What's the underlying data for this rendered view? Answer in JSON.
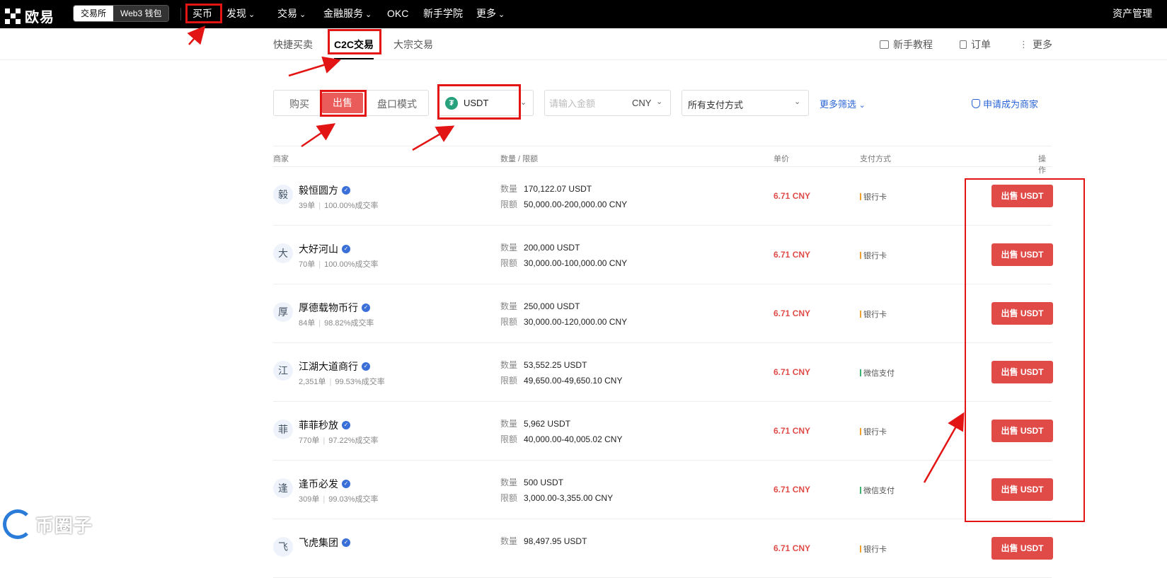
{
  "topnav": {
    "logo": "欧易",
    "segment": {
      "exchange": "交易所",
      "wallet": "Web3 钱包"
    },
    "items": [
      "买币",
      "发现",
      "交易",
      "金融服务",
      "OKC",
      "新手学院",
      "更多"
    ],
    "asset_manage": "资产管理"
  },
  "subnav": {
    "tabs": [
      "快捷买卖",
      "C2C交易",
      "大宗交易"
    ],
    "active_tab": "C2C交易",
    "right": {
      "tutorial": "新手教程",
      "orders": "订单",
      "more": "更多"
    }
  },
  "filters": {
    "trade": {
      "buy": "购买",
      "sell": "出售",
      "orderbook": "盘口模式",
      "active": "出售"
    },
    "coin": "USDT",
    "amount_placeholder": "请输入金额",
    "currency": "CNY",
    "payment": "所有支付方式",
    "more_filters": "更多筛选",
    "apply_merchant": "申请成为商家"
  },
  "table": {
    "headers": {
      "merchant": "商家",
      "qty_limit": "数量 / 限额",
      "price": "单价",
      "payment": "支付方式",
      "action": "操作"
    },
    "qty_label": "数量",
    "limit_label": "限额",
    "rows": [
      {
        "avatar": "毅",
        "name": "毅恒圆方",
        "orders": "39单",
        "rate": "100.00%成交率",
        "qty": "170,122.07 USDT",
        "limit": "50,000.00-200,000.00 CNY",
        "price": "6.71 CNY",
        "payment": "银行卡",
        "pay_color": "#f0a030",
        "action": "出售 USDT"
      },
      {
        "avatar": "大",
        "name": "大好河山",
        "orders": "70单",
        "rate": "100.00%成交率",
        "qty": "200,000 USDT",
        "limit": "30,000.00-100,000.00 CNY",
        "price": "6.71 CNY",
        "payment": "银行卡",
        "pay_color": "#f0a030",
        "action": "出售 USDT"
      },
      {
        "avatar": "厚",
        "name": "厚德载物币行",
        "orders": "84单",
        "rate": "98.82%成交率",
        "qty": "250,000 USDT",
        "limit": "30,000.00-120,000.00 CNY",
        "price": "6.71 CNY",
        "payment": "银行卡",
        "pay_color": "#f0a030",
        "action": "出售 USDT"
      },
      {
        "avatar": "江",
        "name": "江湖大道商行",
        "orders": "2,351单",
        "rate": "99.53%成交率",
        "qty": "53,552.25 USDT",
        "limit": "49,650.00-49,650.10 CNY",
        "price": "6.71 CNY",
        "payment": "微信支付",
        "pay_color": "#3cb371",
        "action": "出售 USDT"
      },
      {
        "avatar": "菲",
        "name": "菲菲秒放",
        "orders": "770单",
        "rate": "97.22%成交率",
        "qty": "5,962 USDT",
        "limit": "40,000.00-40,005.02 CNY",
        "price": "6.71 CNY",
        "payment": "银行卡",
        "pay_color": "#f0a030",
        "action": "出售 USDT"
      },
      {
        "avatar": "逢",
        "name": "逢币必发",
        "orders": "309单",
        "rate": "99.03%成交率",
        "qty": "500 USDT",
        "limit": "3,000.00-3,355.00 CNY",
        "price": "6.71 CNY",
        "payment": "微信支付",
        "pay_color": "#3cb371",
        "action": "出售 USDT"
      },
      {
        "avatar": "飞",
        "name": "飞虎集团",
        "orders": "",
        "rate": "",
        "qty": "98,497.95 USDT",
        "limit": "",
        "price": "6.71 CNY",
        "payment": "银行卡",
        "pay_color": "#f0a030",
        "action": "出售 USDT"
      }
    ]
  },
  "watermark": "币圈子",
  "colors": {
    "accent_red": "#e04b48",
    "highlight_red": "#e31414",
    "link_blue": "#2a64d6"
  }
}
